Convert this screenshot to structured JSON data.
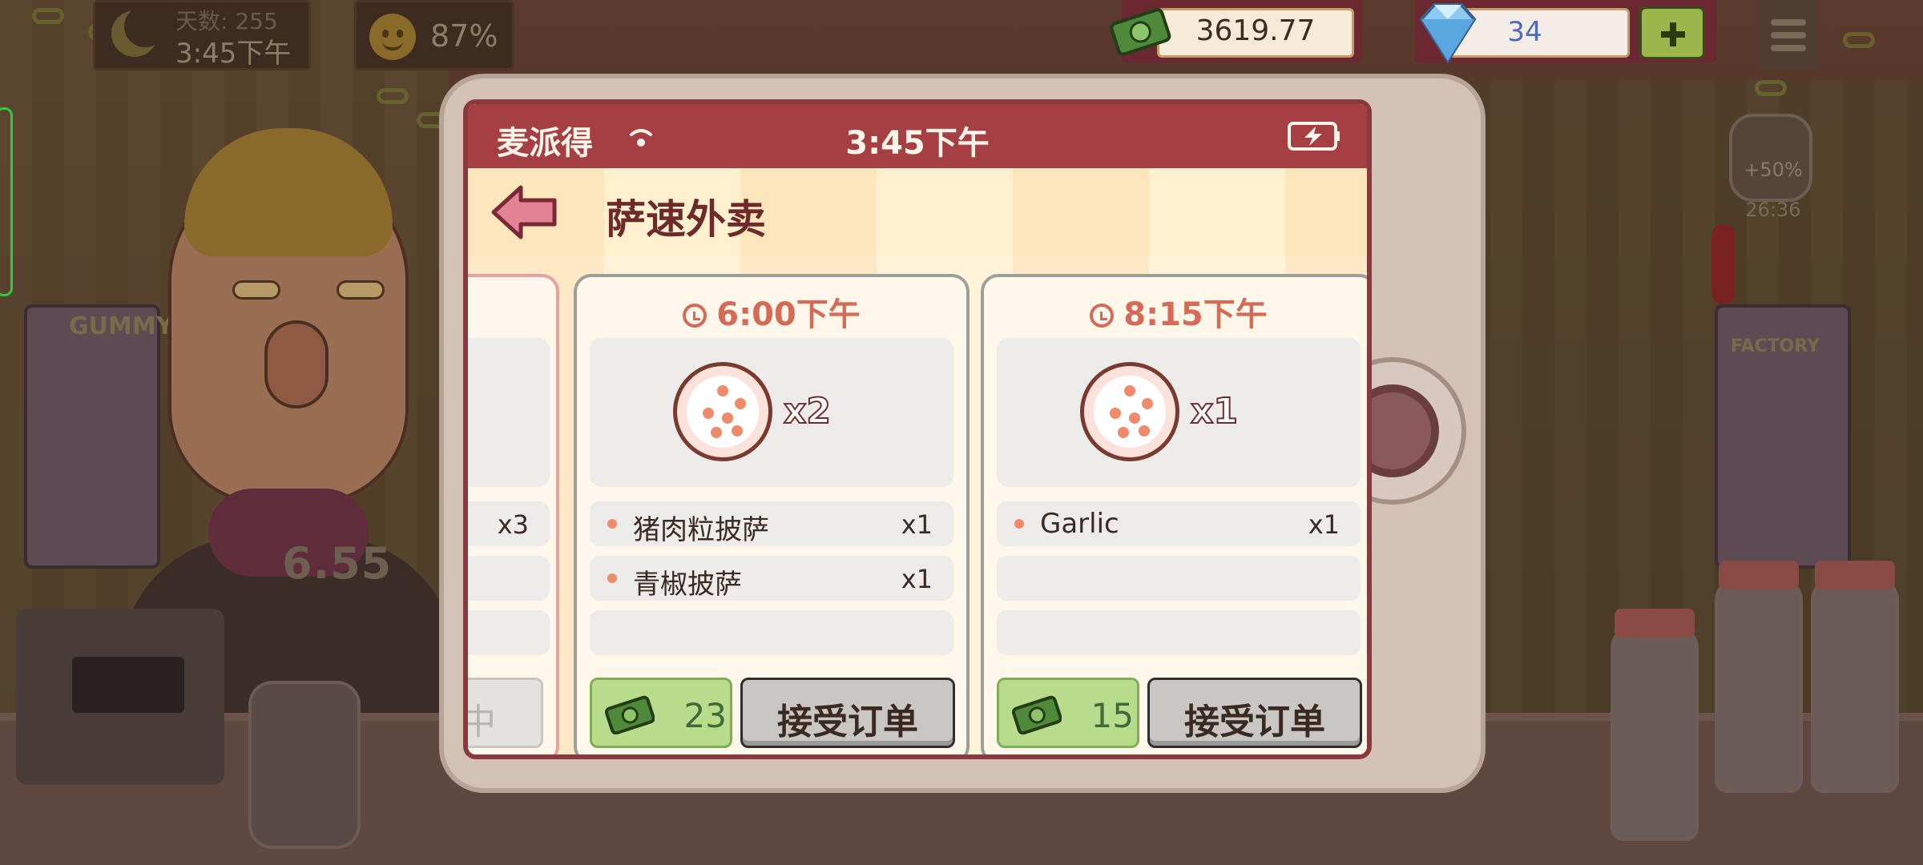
{
  "hud": {
    "day_label": "天数: 255",
    "time": "3:45下午",
    "mood": "87%",
    "money": "3619.77",
    "gems": "34"
  },
  "scene": {
    "tip_amount": "6.55",
    "boost_percent": "+50%",
    "boost_timer": "26:36",
    "arcade_left_label": "GUMMY GU",
    "arcade_right_label": "FACTORY"
  },
  "tablet": {
    "carrier": "麦派得",
    "clock": "3:45下午",
    "app_title": "萨速外卖"
  },
  "orders": {
    "partial": {
      "qty": "x3",
      "button": "中"
    },
    "cards": [
      {
        "time": "6:00下午",
        "pizza_qty": "x2",
        "items": [
          {
            "name": "猪肉粒披萨",
            "qty": "x1"
          },
          {
            "name": "青椒披萨",
            "qty": "x1"
          }
        ],
        "reward": "23",
        "accept": "接受订单"
      },
      {
        "time": "8:15下午",
        "pizza_qty": "x1",
        "items": [
          {
            "name": "Garlic",
            "qty": "x1"
          }
        ],
        "reward": "15",
        "accept": "接受订单"
      }
    ]
  },
  "colors": {
    "status_bar": "#a63f44",
    "accent_time": "#d56a56",
    "reward_green": "#b9dc8c",
    "gem_text": "#4d6ab3"
  }
}
